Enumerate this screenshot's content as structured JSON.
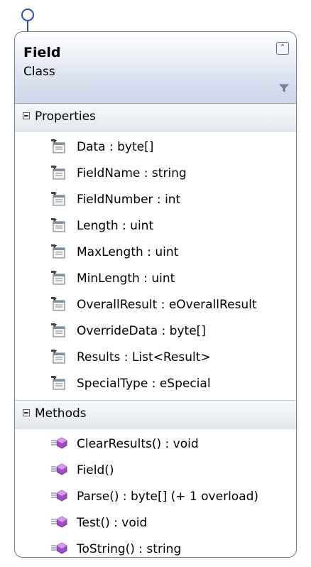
{
  "class": {
    "name": "Field",
    "kind": "Class"
  },
  "sections": {
    "properties": {
      "label": "Properties",
      "items": [
        "Data : byte[]",
        "FieldName : string",
        "FieldNumber : int",
        "Length : uint",
        "MaxLength : uint",
        "MinLength : uint",
        "OverallResult : eOverallResult",
        "OverrideData : byte[]",
        "Results : List<Result>",
        "SpecialType : eSpecial"
      ]
    },
    "methods": {
      "label": "Methods",
      "items": [
        "ClearResults() : void",
        "Field()",
        "Parse() : byte[] (+ 1 overload)",
        "Test() : void",
        "ToString() : string"
      ]
    }
  }
}
